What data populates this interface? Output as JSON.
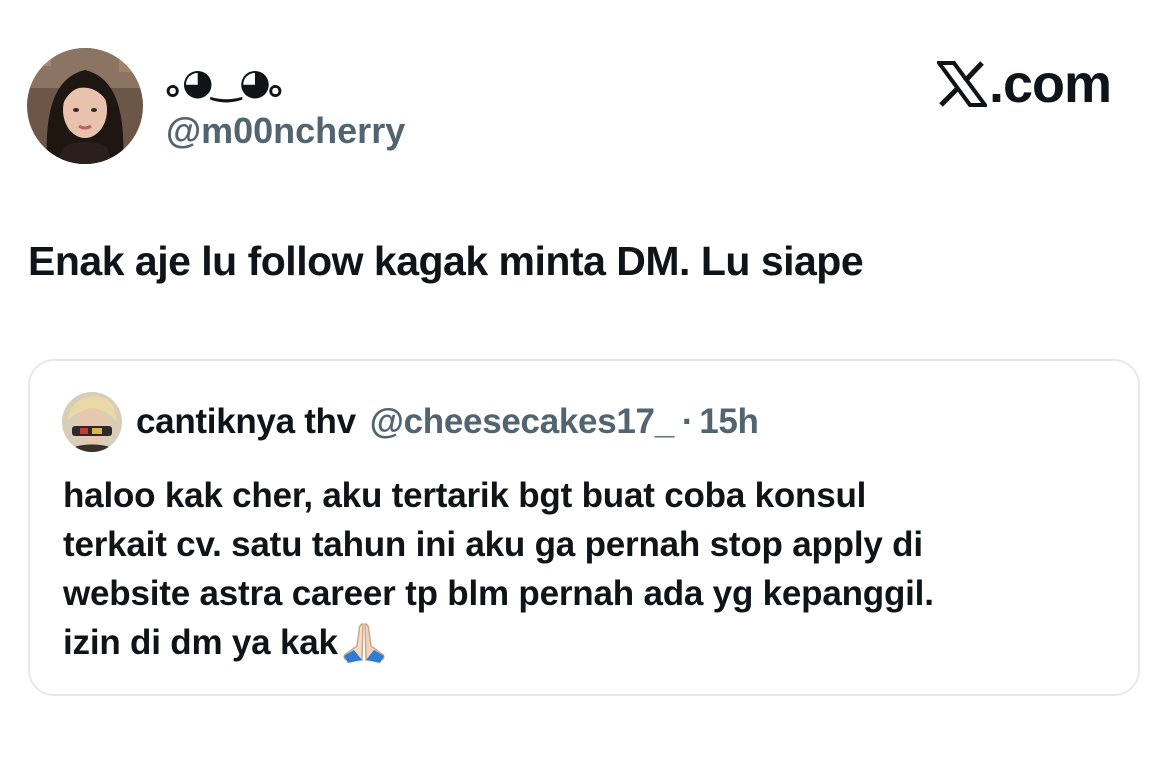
{
  "author": {
    "display_name": "｡◕‿◕｡",
    "handle": "@m00ncherry"
  },
  "brand": {
    "text": ".com",
    "icon": "x-logo-icon"
  },
  "tweet": {
    "text": "Enak aje lu follow kagak minta DM. Lu siape"
  },
  "quote": {
    "display_name": "cantiknya thv",
    "handle": "@cheesecakes17_",
    "separator": "·",
    "time": "15h",
    "lines": [
      "haloo kak cher, aku tertarik bgt buat coba konsul",
      "terkait cv. satu tahun ini aku ga pernah stop apply di",
      "website astra career tp blm pernah ada yg kepanggil.",
      "izin di dm ya kak"
    ],
    "emoji": "folded-hands-emoji"
  },
  "colors": {
    "text_primary": "#0f1419",
    "text_secondary": "#536471",
    "card_border": "#e6e9ec"
  }
}
